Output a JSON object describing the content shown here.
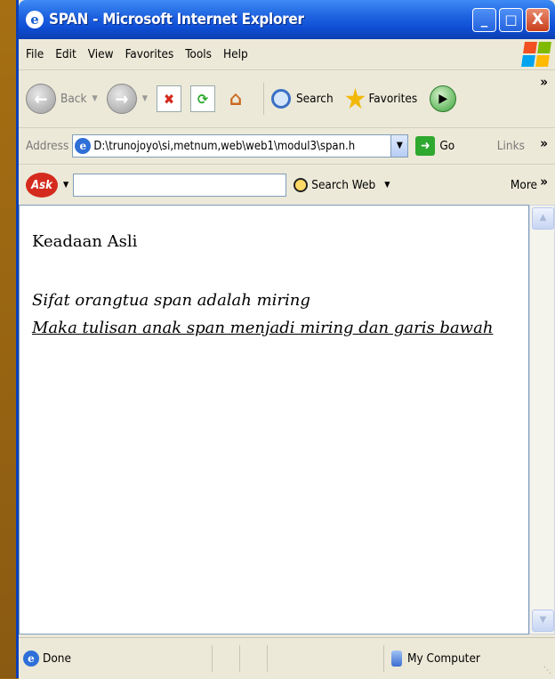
{
  "window": {
    "title": "SPAN - Microsoft Internet Explorer",
    "buttons": {
      "minimize": "_",
      "maximize": "□",
      "close": "X"
    }
  },
  "menubar": {
    "items": [
      {
        "label": "File"
      },
      {
        "label": "Edit"
      },
      {
        "label": "View"
      },
      {
        "label": "Favorites"
      },
      {
        "label": "Tools"
      },
      {
        "label": "Help"
      }
    ]
  },
  "toolbar": {
    "back_label": "Back",
    "search_label": "Search",
    "favorites_label": "Favorites"
  },
  "addressbar": {
    "label": "Address",
    "url": "D:\\trunojoyo\\si,metnum,web\\web1\\modul3\\span.h",
    "go_label": "Go",
    "links_label": "Links"
  },
  "askbar": {
    "logo": "Ask",
    "search_input_value": "",
    "search_web_label": "Search Web",
    "more_label": "More"
  },
  "page": {
    "line1": "Keadaan Asli",
    "line2": "Sifat orangtua span adalah miring",
    "line3": "Maka tulisan anak span menjadi miring dan garis bawah"
  },
  "statusbar": {
    "status_text": "Done",
    "zone_text": "My Computer"
  },
  "colors": {
    "titlebar": "#0f4fd6",
    "chrome": "#ece9d8",
    "close_button": "#c8401c",
    "backdrop": "#9a6a1a"
  }
}
